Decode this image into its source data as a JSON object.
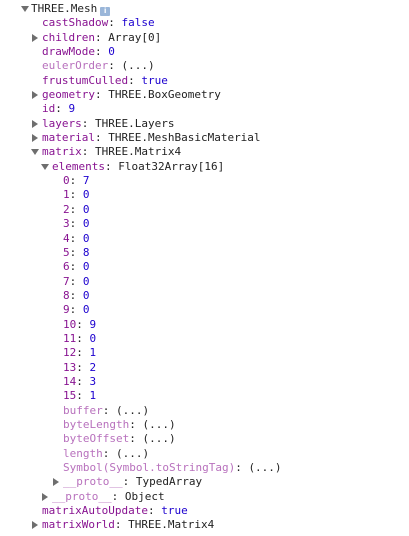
{
  "root": {
    "label": "THREE.Mesh",
    "info_icon": "i"
  },
  "props": {
    "castShadow": {
      "key": "castShadow",
      "sep": ": ",
      "value": "false"
    },
    "children": {
      "key": "children",
      "sep": ": ",
      "value": "Array[0]"
    },
    "drawMode": {
      "key": "drawMode",
      "sep": ": ",
      "value": "0"
    },
    "eulerOrder": {
      "key": "eulerOrder",
      "sep": ": ",
      "value": "(...)"
    },
    "frustumCulled": {
      "key": "frustumCulled",
      "sep": ": ",
      "value": "true"
    },
    "geometry": {
      "key": "geometry",
      "sep": ": ",
      "value": "THREE.BoxGeometry"
    },
    "id": {
      "key": "id",
      "sep": ": ",
      "value": "9"
    },
    "layers": {
      "key": "layers",
      "sep": ": ",
      "value": "THREE.Layers"
    },
    "material": {
      "key": "material",
      "sep": ": ",
      "value": "THREE.MeshBasicMaterial"
    },
    "matrix": {
      "key": "matrix",
      "sep": ": ",
      "value": "THREE.Matrix4"
    },
    "elements": {
      "key": "elements",
      "sep": ": ",
      "value": "Float32Array[16]"
    },
    "matrixAutoUpdate": {
      "key": "matrixAutoUpdate",
      "sep": ": ",
      "value": "true"
    },
    "matrixWorld": {
      "key": "matrixWorld",
      "sep": ": ",
      "value": "THREE.Matrix4"
    }
  },
  "elements_items": [
    {
      "key": "0",
      "sep": ": ",
      "value": "7"
    },
    {
      "key": "1",
      "sep": ": ",
      "value": "0"
    },
    {
      "key": "2",
      "sep": ": ",
      "value": "0"
    },
    {
      "key": "3",
      "sep": ": ",
      "value": "0"
    },
    {
      "key": "4",
      "sep": ": ",
      "value": "0"
    },
    {
      "key": "5",
      "sep": ": ",
      "value": "8"
    },
    {
      "key": "6",
      "sep": ": ",
      "value": "0"
    },
    {
      "key": "7",
      "sep": ": ",
      "value": "0"
    },
    {
      "key": "8",
      "sep": ": ",
      "value": "0"
    },
    {
      "key": "9",
      "sep": ": ",
      "value": "0"
    },
    {
      "key": "10",
      "sep": ": ",
      "value": "9"
    },
    {
      "key": "11",
      "sep": ": ",
      "value": "0"
    },
    {
      "key": "12",
      "sep": ": ",
      "value": "1"
    },
    {
      "key": "13",
      "sep": ": ",
      "value": "2"
    },
    {
      "key": "14",
      "sep": ": ",
      "value": "3"
    },
    {
      "key": "15",
      "sep": ": ",
      "value": "1"
    }
  ],
  "typed_array_getters": [
    {
      "key": "buffer",
      "sep": ": ",
      "value": "(...)"
    },
    {
      "key": "byteLength",
      "sep": ": ",
      "value": "(...)"
    },
    {
      "key": "byteOffset",
      "sep": ": ",
      "value": "(...)"
    },
    {
      "key": "length",
      "sep": ": ",
      "value": "(...)"
    },
    {
      "key": "Symbol(Symbol.toStringTag)",
      "sep": ": ",
      "value": "(...)"
    }
  ],
  "elements_proto": {
    "key": "__proto__",
    "sep": ": ",
    "value": "TypedArray"
  },
  "matrix_proto": {
    "key": "__proto__",
    "sep": ": ",
    "value": "Object"
  },
  "colors": {
    "key": "#881391",
    "key_dim": "#b871bd",
    "value_literal": "#1c00cf",
    "text": "#222222",
    "triangle": "#6e6e6e"
  }
}
